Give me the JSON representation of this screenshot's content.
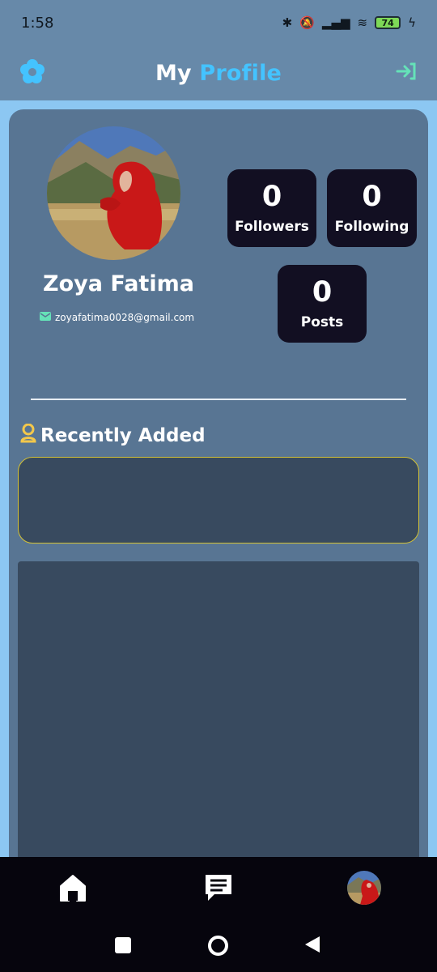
{
  "status": {
    "time": "1:58",
    "battery": "74"
  },
  "header": {
    "title_part1": "My",
    "title_part2": "Profile"
  },
  "profile": {
    "name": "Zoya Fatima",
    "email": "zoyafatima0028@gmail.com"
  },
  "stats": {
    "followers": {
      "count": "0",
      "label": "Followers"
    },
    "following": {
      "count": "0",
      "label": "Following"
    },
    "posts": {
      "count": "0",
      "label": "Posts"
    }
  },
  "recent": {
    "title": "Recently Added"
  },
  "icons": [
    "settings-flower-icon",
    "logout-icon",
    "mail-icon",
    "recent-icon",
    "home-icon",
    "chat-icon",
    "avatar"
  ],
  "colors": {
    "accent": "#44c3ff",
    "logout": "#65e2b8",
    "recent_border": "#d4c236",
    "stat_bg": "#120f22"
  }
}
